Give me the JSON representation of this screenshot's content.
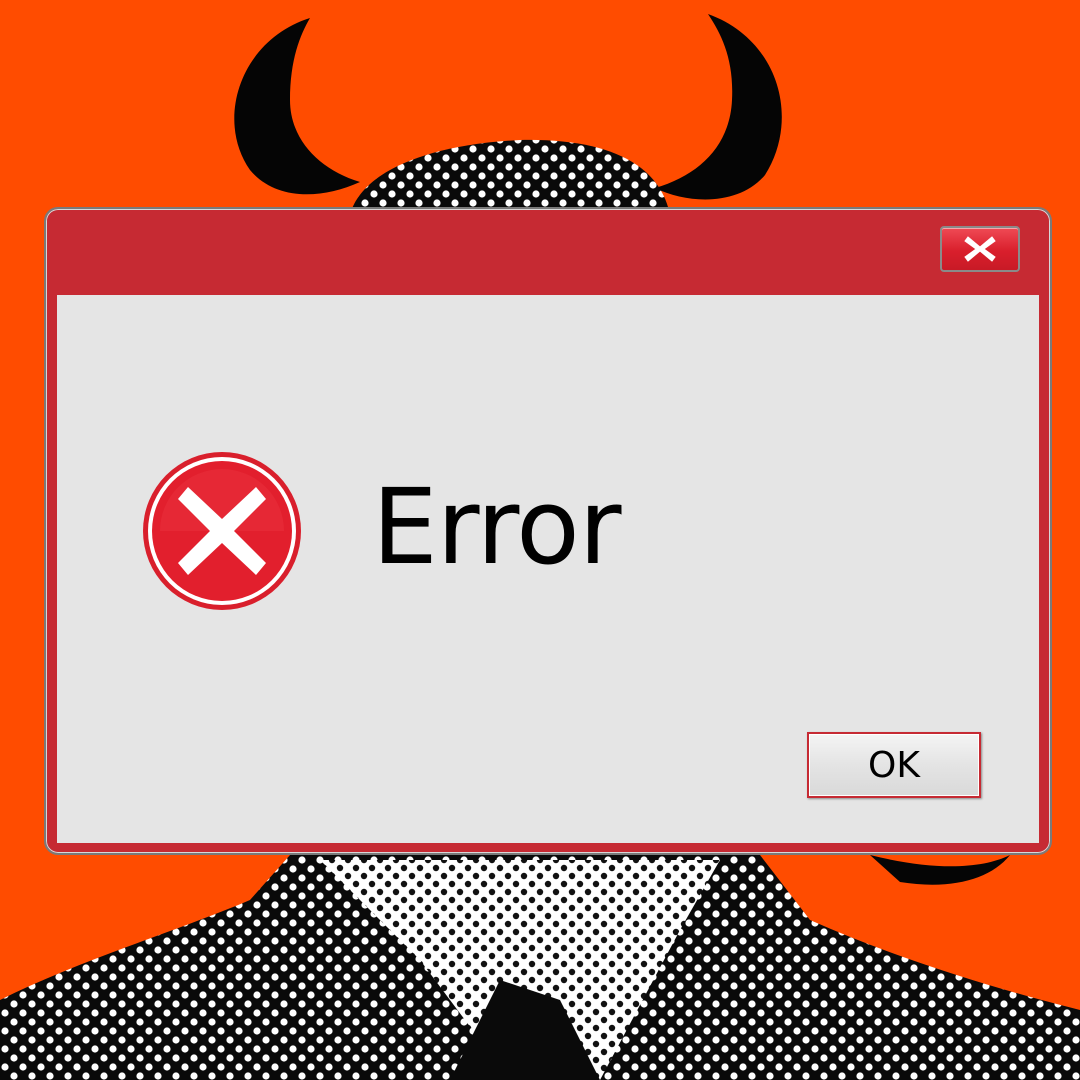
{
  "theme": {
    "background": "#ff4c00",
    "dialog_frame": "#c62a33",
    "dialog_client": "#e5e5e5",
    "error_red": "#d91f2c"
  },
  "dialog": {
    "title": "",
    "close_icon": "close-icon",
    "status_icon": "error-icon",
    "message": "Error",
    "ok_label": "OK"
  }
}
